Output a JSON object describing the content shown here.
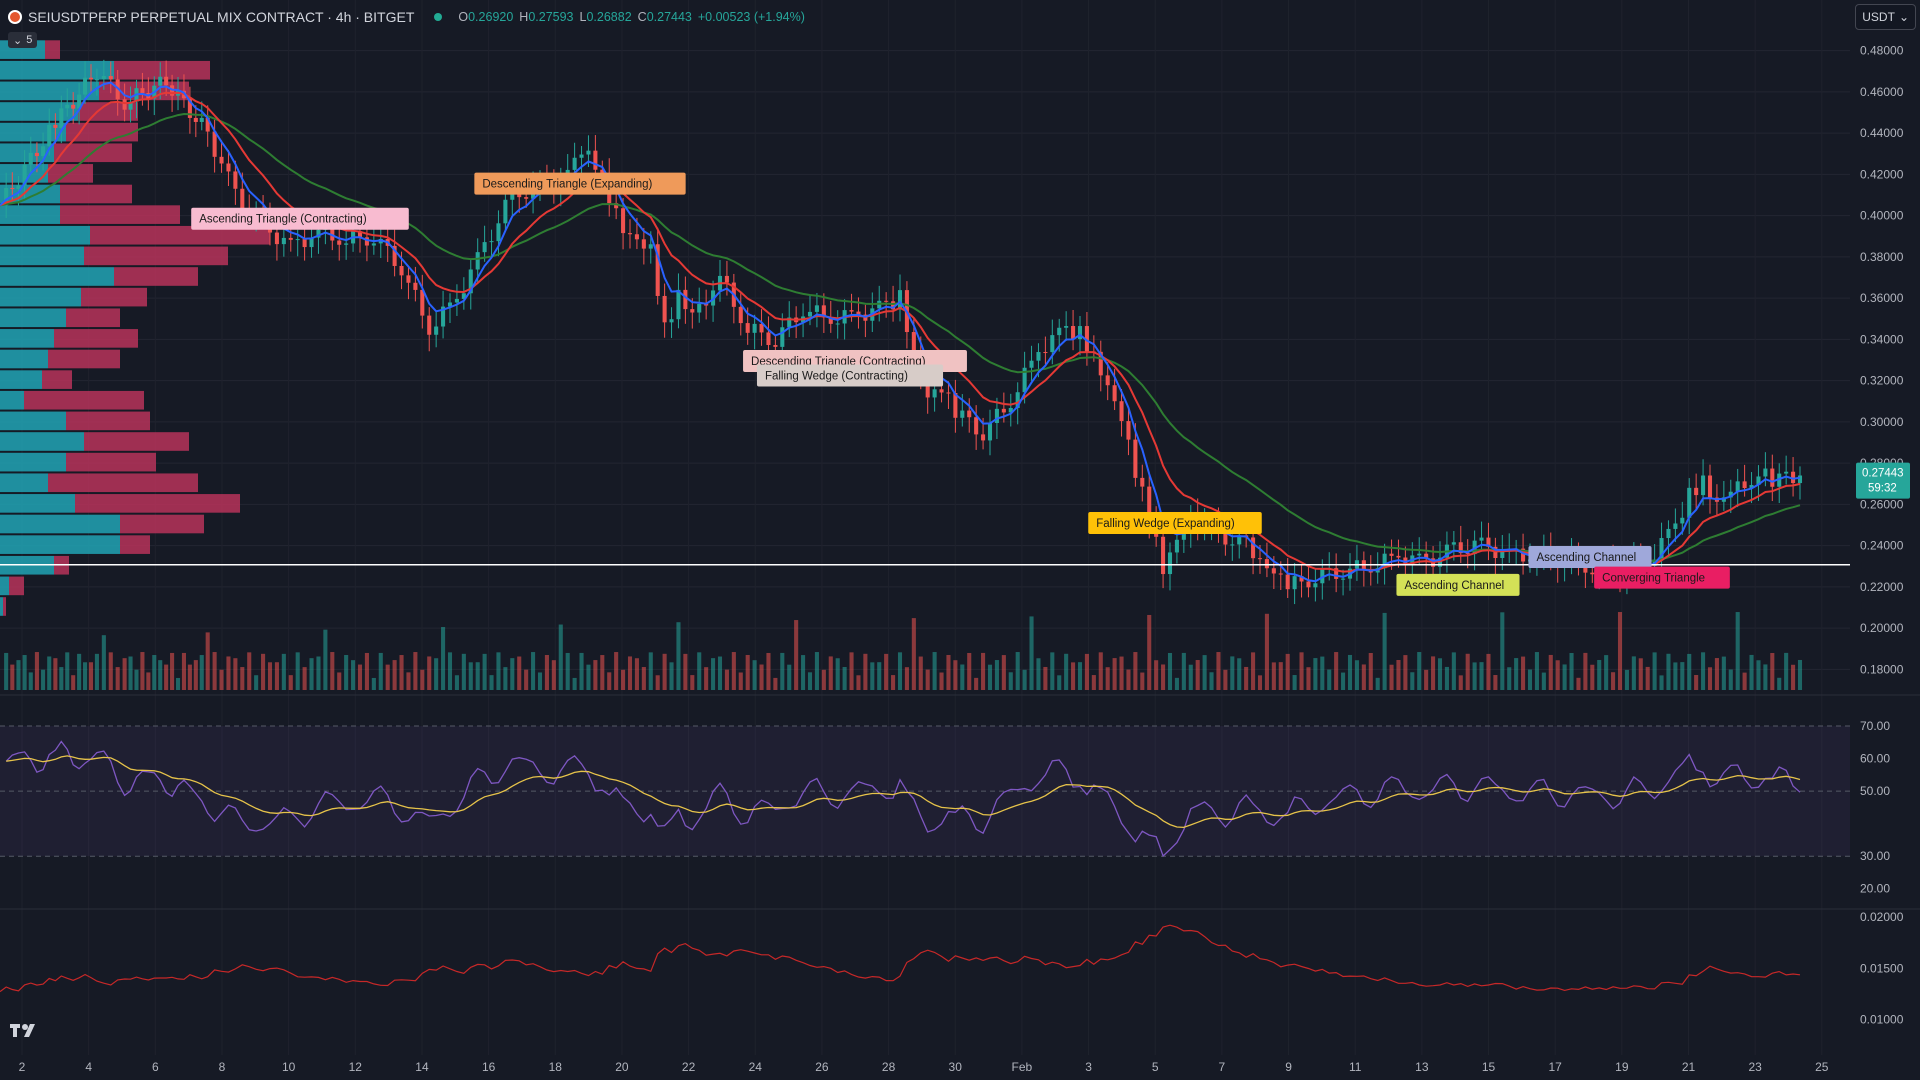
{
  "header": {
    "symbol": "SEIUSDTPERP PERPETUAL MIX CONTRACT · 4h · BITGET",
    "open_label": "O",
    "open": "0.26920",
    "high_label": "H",
    "high": "0.27593",
    "low_label": "L",
    "low": "0.26882",
    "close_label": "C",
    "close": "0.27443",
    "change": "+0.00523 (+1.94%)"
  },
  "indicators_collapsed_label": "5",
  "currency_selector": "USDT",
  "icons": [
    "bitget-logo-icon",
    "live-dot-icon",
    "chevron-down-icon",
    "tradingview-logo-icon"
  ],
  "colors": {
    "background": "#161a25",
    "up": "#26a69a",
    "down": "#ef5350",
    "ema_fast": "#2962ff",
    "ema_mid": "#e53935",
    "ema_slow": "#2e7d32",
    "rsi": "#7e57c2",
    "rsi_ma": "#e6c34a",
    "vp_up": "#21a5b5",
    "vp_down": "#c2345e",
    "line3": "#c62828"
  },
  "chart_data": {
    "type": "candlestick",
    "price_axis": {
      "ticks": [
        "0.48000",
        "0.46000",
        "0.44000",
        "0.42000",
        "0.40000",
        "0.38000",
        "0.36000",
        "0.34000",
        "0.32000",
        "0.30000",
        "0.28000",
        "0.26000",
        "0.24000",
        "0.22000",
        "0.20000",
        "0.18000"
      ],
      "range": [
        0.17,
        0.49
      ]
    },
    "last_price": {
      "value": "0.27443",
      "countdown": "59:32"
    },
    "horizontal_line": 0.2307,
    "x_axis": {
      "labels": [
        "2",
        "4",
        "6",
        "8",
        "10",
        "12",
        "14",
        "16",
        "18",
        "20",
        "22",
        "24",
        "26",
        "28",
        "30",
        "Feb",
        "3",
        "5",
        "7",
        "9",
        "11",
        "13",
        "15",
        "17",
        "19",
        "21",
        "23",
        "25"
      ]
    },
    "price_series": [
      [
        0,
        0.405
      ],
      [
        4,
        0.445
      ],
      [
        7,
        0.47
      ],
      [
        9,
        0.455
      ],
      [
        12,
        0.465
      ],
      [
        15,
        0.44
      ],
      [
        17,
        0.41
      ],
      [
        19,
        0.395
      ],
      [
        21,
        0.385
      ],
      [
        23,
        0.392
      ],
      [
        25,
        0.388
      ],
      [
        27,
        0.39
      ],
      [
        29,
        0.375
      ],
      [
        31,
        0.345
      ],
      [
        33,
        0.36
      ],
      [
        35,
        0.385
      ],
      [
        37,
        0.41
      ],
      [
        39,
        0.413
      ],
      [
        41,
        0.42
      ],
      [
        42,
        0.43
      ],
      [
        43,
        0.425
      ],
      [
        44,
        0.41
      ],
      [
        45,
        0.395
      ],
      [
        46,
        0.39
      ],
      [
        47,
        0.385
      ],
      [
        48,
        0.345
      ],
      [
        49,
        0.36
      ],
      [
        50,
        0.35
      ],
      [
        52,
        0.37
      ],
      [
        54,
        0.345
      ],
      [
        56,
        0.34
      ],
      [
        58,
        0.355
      ],
      [
        60,
        0.35
      ],
      [
        62,
        0.352
      ],
      [
        64,
        0.356
      ],
      [
        65,
        0.36
      ],
      [
        66,
        0.33
      ],
      [
        67,
        0.31
      ],
      [
        68,
        0.315
      ],
      [
        69,
        0.305
      ],
      [
        71,
        0.295
      ],
      [
        73,
        0.31
      ],
      [
        75,
        0.335
      ],
      [
        77,
        0.345
      ],
      [
        78,
        0.343
      ],
      [
        79,
        0.33
      ],
      [
        80,
        0.315
      ],
      [
        81,
        0.3
      ],
      [
        82,
        0.275
      ],
      [
        83,
        0.255
      ],
      [
        84,
        0.23
      ],
      [
        85,
        0.245
      ],
      [
        86,
        0.255
      ],
      [
        88,
        0.245
      ],
      [
        90,
        0.24
      ],
      [
        91,
        0.23
      ],
      [
        92,
        0.225
      ],
      [
        93,
        0.22
      ],
      [
        95,
        0.225
      ],
      [
        97,
        0.228
      ],
      [
        99,
        0.23
      ],
      [
        101,
        0.235
      ],
      [
        103,
        0.232
      ],
      [
        105,
        0.238
      ],
      [
        107,
        0.24
      ],
      [
        109,
        0.236
      ],
      [
        111,
        0.235
      ],
      [
        113,
        0.233
      ],
      [
        115,
        0.23
      ],
      [
        117,
        0.228
      ],
      [
        119,
        0.232
      ],
      [
        121,
        0.25
      ],
      [
        122,
        0.265
      ],
      [
        123,
        0.27
      ],
      [
        124,
        0.258
      ],
      [
        125,
        0.265
      ],
      [
        127,
        0.275
      ],
      [
        128,
        0.272
      ],
      [
        130,
        0.274
      ]
    ],
    "volume_profile": {
      "rows_up": [
        0.15,
        0.38,
        0.33,
        0.26,
        0.22,
        0.18,
        0.16,
        0.2,
        0.2,
        0.3,
        0.28,
        0.38,
        0.27,
        0.22,
        0.18,
        0.16,
        0.14,
        0.08,
        0.22,
        0.28,
        0.22,
        0.16,
        0.25,
        0.4,
        0.4,
        0.18,
        0.03,
        0.01
      ],
      "rows_down": [
        0.05,
        0.32,
        0.3,
        0.2,
        0.24,
        0.26,
        0.15,
        0.24,
        0.4,
        0.6,
        0.48,
        0.28,
        0.22,
        0.18,
        0.28,
        0.24,
        0.1,
        0.4,
        0.28,
        0.35,
        0.3,
        0.5,
        0.55,
        0.28,
        0.1,
        0.05,
        0.05,
        0.01
      ]
    },
    "patterns": [
      "Ascending Triangle (Contracting)",
      "Descending Triangle (Expanding)",
      "Descending Triangle (Contracting)",
      "Falling Wedge (Contracting)",
      "Falling Wedge (Expanding)",
      "Ascending Channel",
      "Ascending Channel",
      "Converging Triangle"
    ],
    "rsi": {
      "ticks": [
        "70.00",
        "60.00",
        "50.00",
        "30.00",
        "20.00"
      ],
      "range": [
        15,
        78
      ],
      "bands": [
        70,
        50,
        30
      ]
    },
    "lower_indicator": {
      "ticks": [
        "0.02000",
        "0.01500",
        "0.01000"
      ],
      "range": [
        0.0075,
        0.0205
      ]
    }
  }
}
